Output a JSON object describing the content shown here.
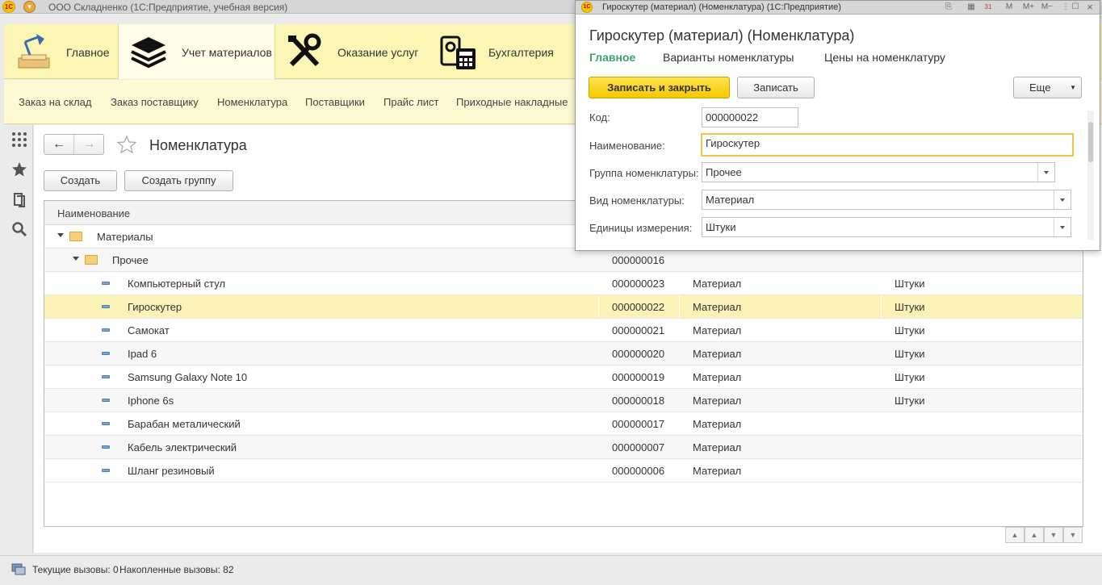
{
  "titlebar": {
    "app_title": "ООО Складненко  (1С:Предприятие, учебная версия)"
  },
  "sections": [
    {
      "label": "Главное",
      "icon": "desk-lamp-icon",
      "active": false
    },
    {
      "label": "Учет материалов",
      "icon": "layers-icon",
      "active": true
    },
    {
      "label": "Оказание услуг",
      "icon": "tools-icon",
      "active": false
    },
    {
      "label": "Бухгалтерия",
      "icon": "calculator-icon",
      "active": false
    }
  ],
  "nav": [
    "Заказ на склад",
    "Заказ поставщику",
    "Номенклатура",
    "Поставщики",
    "Прайс лист",
    "Приходные накладные"
  ],
  "form": {
    "title": "Номенклатура",
    "create_label": "Создать",
    "create_group_label": "Создать группу",
    "col_name": "Наименование"
  },
  "rows": [
    {
      "name": "Материалы",
      "code": "",
      "kind": "",
      "unit": "",
      "type": "group",
      "level": 0
    },
    {
      "name": "Прочее",
      "code": "000000016",
      "kind": "",
      "unit": "",
      "type": "group",
      "level": 1
    },
    {
      "name": "Компьютерный стул",
      "code": "000000023",
      "kind": "Материал",
      "unit": "Штуки",
      "type": "item",
      "level": 2
    },
    {
      "name": "Гироскутер",
      "code": "000000022",
      "kind": "Материал",
      "unit": "Штуки",
      "type": "item",
      "level": 2
    },
    {
      "name": "Самокат",
      "code": "000000021",
      "kind": "Материал",
      "unit": "Штуки",
      "type": "item",
      "level": 2
    },
    {
      "name": "Ipad 6",
      "code": "000000020",
      "kind": "Материал",
      "unit": "Штуки",
      "type": "item",
      "level": 2
    },
    {
      "name": "Samsung Galaxy Note 10",
      "code": "000000019",
      "kind": "Материал",
      "unit": "Штуки",
      "type": "item",
      "level": 2
    },
    {
      "name": "Iphone 6s",
      "code": "000000018",
      "kind": "Материал",
      "unit": "Штуки",
      "type": "item",
      "level": 2
    },
    {
      "name": "Барабан металический",
      "code": "000000017",
      "kind": "Материал",
      "unit": "",
      "type": "item",
      "level": 2
    },
    {
      "name": "Кабель электрический",
      "code": "000000007",
      "kind": "Материал",
      "unit": "",
      "type": "item",
      "level": 2
    },
    {
      "name": "Шланг резиновый",
      "code": "000000006",
      "kind": "Материал",
      "unit": "",
      "type": "item",
      "level": 2
    }
  ],
  "selected_row": 3,
  "status": {
    "current_calls": "Текущие вызовы: 0",
    "accumulated_calls": "Накопленные вызовы: 82"
  },
  "item_window": {
    "window_title": "Гироскутер (материал) (Номенклатура)  (1С:Предприятие)",
    "title": "Гироскутер (материал) (Номенклатура)",
    "tabs": [
      "Главное",
      "Варианты номенклатуры",
      "Цены на номенклатуру"
    ],
    "save_close_label": "Записать и закрыть",
    "save_label": "Записать",
    "more_label": "Еще",
    "toolbar_m": "M",
    "toolbar_mplus": "M+",
    "toolbar_mminus": "M−",
    "calendar_day": "31",
    "fields": {
      "code_label": "Код:",
      "code_value": "000000022",
      "name_label": "Наименование:",
      "name_value": "Гироскутер",
      "group_label": "Группа номенклатуры:",
      "group_value": "Прочее",
      "kind_label": "Вид номенклатуры:",
      "kind_value": "Материал",
      "unit_label": "Единицы измерения:",
      "unit_value": "Штуки"
    }
  },
  "colors": {
    "accent_yellow": "#f5c800",
    "section_bg": "#fcf6b5",
    "active_tab_green": "#3aa56a",
    "selected_row": "#fbf2b8"
  }
}
